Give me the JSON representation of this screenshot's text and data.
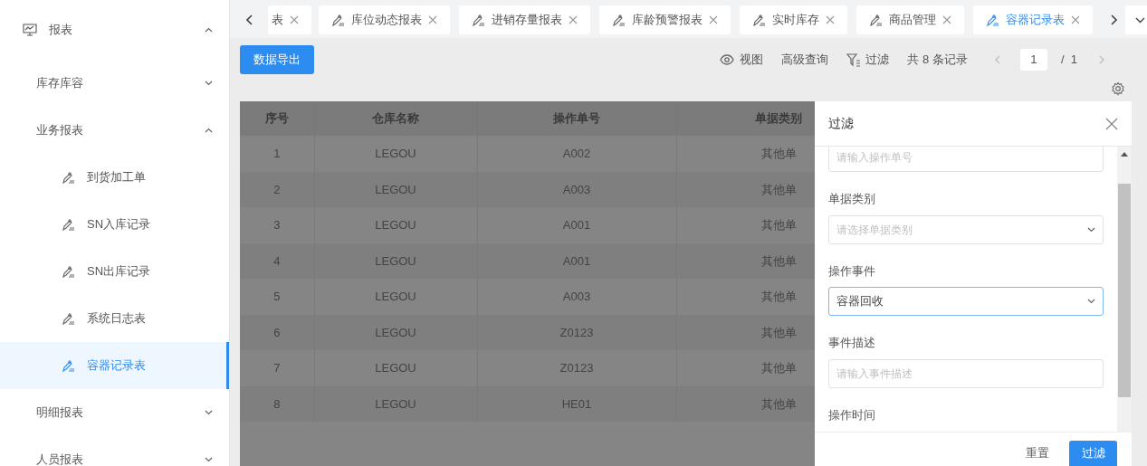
{
  "sidebar": {
    "items": [
      {
        "label": "报表",
        "expanded": true,
        "children": [
          {
            "label": "库存库容",
            "expanded": false
          },
          {
            "label": "业务报表",
            "expanded": true,
            "children": [
              {
                "label": "到货加工单",
                "selected": false
              },
              {
                "label": "SN入库记录",
                "selected": false
              },
              {
                "label": "SN出库记录",
                "selected": false
              },
              {
                "label": "系统日志表",
                "selected": false
              },
              {
                "label": "容器记录表",
                "selected": true
              }
            ]
          },
          {
            "label": "明细报表",
            "expanded": false
          },
          {
            "label": "人员报表",
            "expanded": false
          }
        ]
      }
    ]
  },
  "tabs": [
    {
      "label": "表",
      "selected": false,
      "icon": false
    },
    {
      "label": "库位动态报表",
      "selected": false,
      "icon": true
    },
    {
      "label": "进销存量报表",
      "selected": false,
      "icon": true
    },
    {
      "label": "库龄预警报表",
      "selected": false,
      "icon": true
    },
    {
      "label": "实时库存",
      "selected": false,
      "icon": true
    },
    {
      "label": "商品管理",
      "selected": false,
      "icon": true
    },
    {
      "label": "容器记录表",
      "selected": true,
      "icon": true
    }
  ],
  "toolbar": {
    "export_button": "数据导出",
    "view": "视图",
    "advanced_query": "高级查询",
    "filter": "过滤",
    "total": "共 8 条记录",
    "page": "1",
    "page_total": "/  1"
  },
  "table": {
    "columns": [
      "序号",
      "仓库名称",
      "操作单号",
      "单据类别"
    ],
    "rows": [
      [
        "1",
        "LEGOU",
        "A002",
        "其他单"
      ],
      [
        "2",
        "LEGOU",
        "A003",
        "其他单"
      ],
      [
        "3",
        "LEGOU",
        "A001",
        "其他单"
      ],
      [
        "4",
        "LEGOU",
        "A001",
        "其他单"
      ],
      [
        "5",
        "LEGOU",
        "A003",
        "其他单"
      ],
      [
        "6",
        "LEGOU",
        "Z0123",
        "其他单"
      ],
      [
        "7",
        "LEGOU",
        "Z0123",
        "其他单"
      ],
      [
        "8",
        "LEGOU",
        "HE01",
        "其他单"
      ]
    ]
  },
  "drawer": {
    "title": "过滤",
    "fields": [
      {
        "kind": "input",
        "placeholder": "请输入操作单号",
        "focused": false
      },
      {
        "kind": "select",
        "label": "单据类别",
        "placeholder": "请选择单据类别",
        "focused": false
      },
      {
        "kind": "select",
        "label": "操作事件",
        "value": "容器回收",
        "focused": true
      },
      {
        "kind": "input",
        "label": "事件描述",
        "placeholder": "请输入事件描述",
        "focused": false
      },
      {
        "kind": "label",
        "label": "操作时间"
      }
    ],
    "reset_button": "重置",
    "submit_button": "过滤"
  }
}
